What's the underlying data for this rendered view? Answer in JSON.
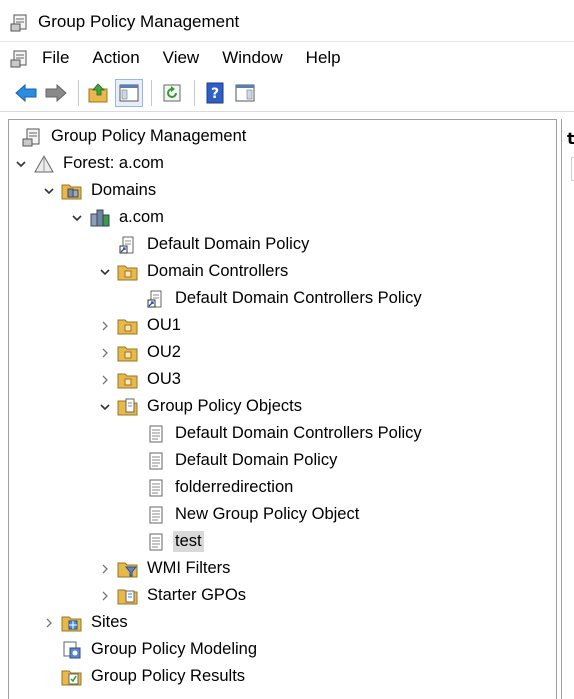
{
  "window": {
    "title": "Group Policy Management"
  },
  "menu": {
    "items": [
      "File",
      "Action",
      "View",
      "Window",
      "Help"
    ]
  },
  "toolbar": {
    "buttons": [
      "back-icon",
      "forward-icon",
      "up-folder-icon",
      "show-hide-tree-icon",
      "refresh-icon",
      "help-icon",
      "properties-icon"
    ]
  },
  "tree": {
    "rows": [
      {
        "label": "Group Policy Management",
        "icon": "gpm-console-icon",
        "depth": 0,
        "chevron": "none",
        "selected": false
      },
      {
        "label": "Forest: a.com",
        "icon": "forest-icon",
        "depth": 0,
        "chevron": "expanded",
        "selected": false
      },
      {
        "label": "Domains",
        "icon": "domains-folder-icon",
        "depth": 1,
        "chevron": "expanded",
        "selected": false
      },
      {
        "label": "a.com",
        "icon": "domain-icon",
        "depth": 2,
        "chevron": "expanded",
        "selected": false
      },
      {
        "label": "Default Domain Policy",
        "icon": "gpo-link-icon",
        "depth": 3,
        "chevron": "none",
        "selected": false
      },
      {
        "label": "Domain Controllers",
        "icon": "ou-folder-icon",
        "depth": 3,
        "chevron": "expanded",
        "selected": false
      },
      {
        "label": "Default Domain Controllers Policy",
        "icon": "gpo-link-icon",
        "depth": 4,
        "chevron": "none",
        "selected": false
      },
      {
        "label": "OU1",
        "icon": "ou-folder-icon",
        "depth": 3,
        "chevron": "collapsed",
        "selected": false
      },
      {
        "label": "OU2",
        "icon": "ou-folder-icon",
        "depth": 3,
        "chevron": "collapsed",
        "selected": false
      },
      {
        "label": "OU3",
        "icon": "ou-folder-icon",
        "depth": 3,
        "chevron": "collapsed",
        "selected": false
      },
      {
        "label": "Group Policy Objects",
        "icon": "gpo-folder-icon",
        "depth": 3,
        "chevron": "expanded",
        "selected": false
      },
      {
        "label": "Default Domain Controllers Policy",
        "icon": "gpo-icon",
        "depth": 4,
        "chevron": "none",
        "selected": false
      },
      {
        "label": "Default Domain Policy",
        "icon": "gpo-icon",
        "depth": 4,
        "chevron": "none",
        "selected": false
      },
      {
        "label": "folderredirection",
        "icon": "gpo-icon",
        "depth": 4,
        "chevron": "none",
        "selected": false
      },
      {
        "label": "New Group Policy Object",
        "icon": "gpo-icon",
        "depth": 4,
        "chevron": "none",
        "selected": false
      },
      {
        "label": "test",
        "icon": "gpo-icon",
        "depth": 4,
        "chevron": "none",
        "selected": true
      },
      {
        "label": "WMI Filters",
        "icon": "wmi-filter-folder-icon",
        "depth": 3,
        "chevron": "collapsed",
        "selected": false
      },
      {
        "label": "Starter GPOs",
        "icon": "starter-gpo-folder-icon",
        "depth": 3,
        "chevron": "collapsed",
        "selected": false
      },
      {
        "label": "Sites",
        "icon": "sites-folder-icon",
        "depth": 1,
        "chevron": "collapsed",
        "selected": false
      },
      {
        "label": "Group Policy Modeling",
        "icon": "gp-modeling-icon",
        "depth": 1,
        "chevron": "none",
        "selected": false
      },
      {
        "label": "Group Policy Results",
        "icon": "gp-results-icon",
        "depth": 1,
        "chevron": "none",
        "selected": false
      }
    ]
  },
  "right_pane": {
    "visible_text": "t"
  }
}
